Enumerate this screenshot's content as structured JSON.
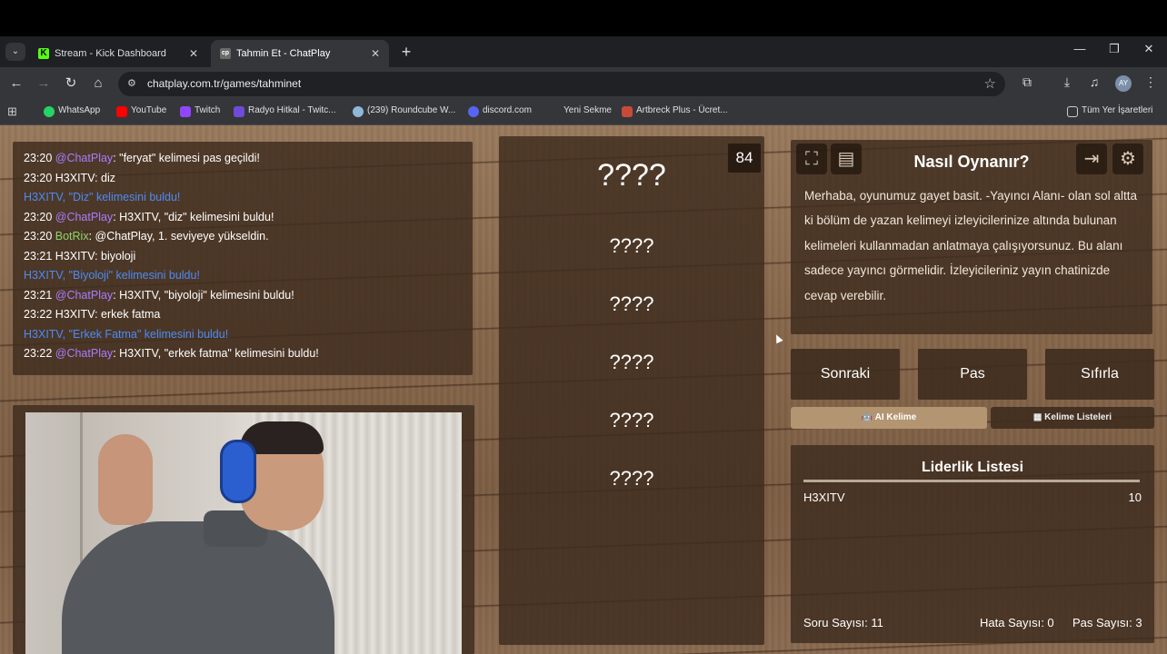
{
  "browser": {
    "tabs": [
      {
        "label": "Stream - Kick Dashboard",
        "favicon": "K",
        "active": false
      },
      {
        "label": "Tahmin Et - ChatPlay",
        "favicon": "cp",
        "active": true
      }
    ],
    "url": "chatplay.com.tr/games/tahminet",
    "profile_initials": "AY",
    "bookmarks": [
      {
        "label": "WhatsApp",
        "color": "#25d366"
      },
      {
        "label": "YouTube",
        "color": "#ff0000"
      },
      {
        "label": "Twitch",
        "color": "#9146ff"
      },
      {
        "label": "Radyo Hitkal - Twitc...",
        "color": "#6f4bd8"
      },
      {
        "label": "(239) Roundcube W...",
        "color": "#8fb8d8"
      },
      {
        "label": "discord.com",
        "color": "#5865f2"
      },
      {
        "label": "Yeni Sekme",
        "color": "#444"
      },
      {
        "label": "Artbreck Plus - Ücret...",
        "color": "#c94a3a"
      }
    ],
    "all_bookmarks": "Tüm Yer İşaretleri"
  },
  "chat": [
    {
      "time": "23:20",
      "user": "@ChatPlay",
      "user_color": "purple",
      "text": ": \"feryat\" kelimesi pas geçildi!"
    },
    {
      "time": "23:20",
      "user": "H3XITV",
      "user_color": "white",
      "text": ": diz"
    },
    {
      "time": "",
      "user": "H3XITV",
      "user_color": "blue",
      "text": ", \"Diz\" kelimesini buldu!"
    },
    {
      "time": "23:20",
      "user": "@ChatPlay",
      "user_color": "purple",
      "text": ": H3XITV, \"diz\" kelimesini buldu!"
    },
    {
      "time": "23:20",
      "user": "BotRix",
      "user_color": "green",
      "text": ": @ChatPlay, 1. seviyeye yükseldin."
    },
    {
      "time": "23:21",
      "user": "H3XITV",
      "user_color": "white",
      "text": ": biyoloji"
    },
    {
      "time": "",
      "user": "H3XITV",
      "user_color": "blue",
      "text": ", \"Biyoloji\" kelimesini buldu!"
    },
    {
      "time": "23:21",
      "user": "@ChatPlay",
      "user_color": "purple",
      "text": ": H3XITV, \"biyoloji\" kelimesini buldu!"
    },
    {
      "time": "23:22",
      "user": "H3XITV",
      "user_color": "white",
      "text": ": erkek fatma"
    },
    {
      "time": "",
      "user": "H3XITV",
      "user_color": "blue",
      "text": ", \"Erkek Fatma\" kelimesini buldu!"
    },
    {
      "time": "23:22",
      "user": "@ChatPlay",
      "user_color": "purple",
      "text": ": H3XITV, \"erkek fatma\" kelimesini buldu!"
    }
  ],
  "game": {
    "counter": "84",
    "main_word": "????",
    "forbidden_words": [
      "????",
      "????",
      "????",
      "????",
      "????"
    ]
  },
  "howto": {
    "title": "Nasıl Oynanır?",
    "body": "Merhaba, oyunumuz gayet basit. -Yayıncı Alanı- olan sol altta ki bölüm de yazan kelimeyi izleyicilerinize altında bulunan kelimeleri kullanmadan anlatmaya çalışıyorsunuz. Bu alanı sadece yayıncı görmelidir. İzleyicileriniz yayın chatinizde cevap verebilir."
  },
  "controls": {
    "next": "Sonraki",
    "pass": "Pas",
    "reset": "Sıfırla",
    "ai_word": "AI Kelime",
    "word_lists": "Kelime Listeleri"
  },
  "leaderboard": {
    "title": "Liderlik Listesi",
    "rows": [
      {
        "name": "H3XITV",
        "score": "10"
      }
    ],
    "question_count": "Soru Sayısı: 11",
    "error_count": "Hata Sayısı: 0",
    "pass_count": "Pas Sayısı: 3"
  }
}
